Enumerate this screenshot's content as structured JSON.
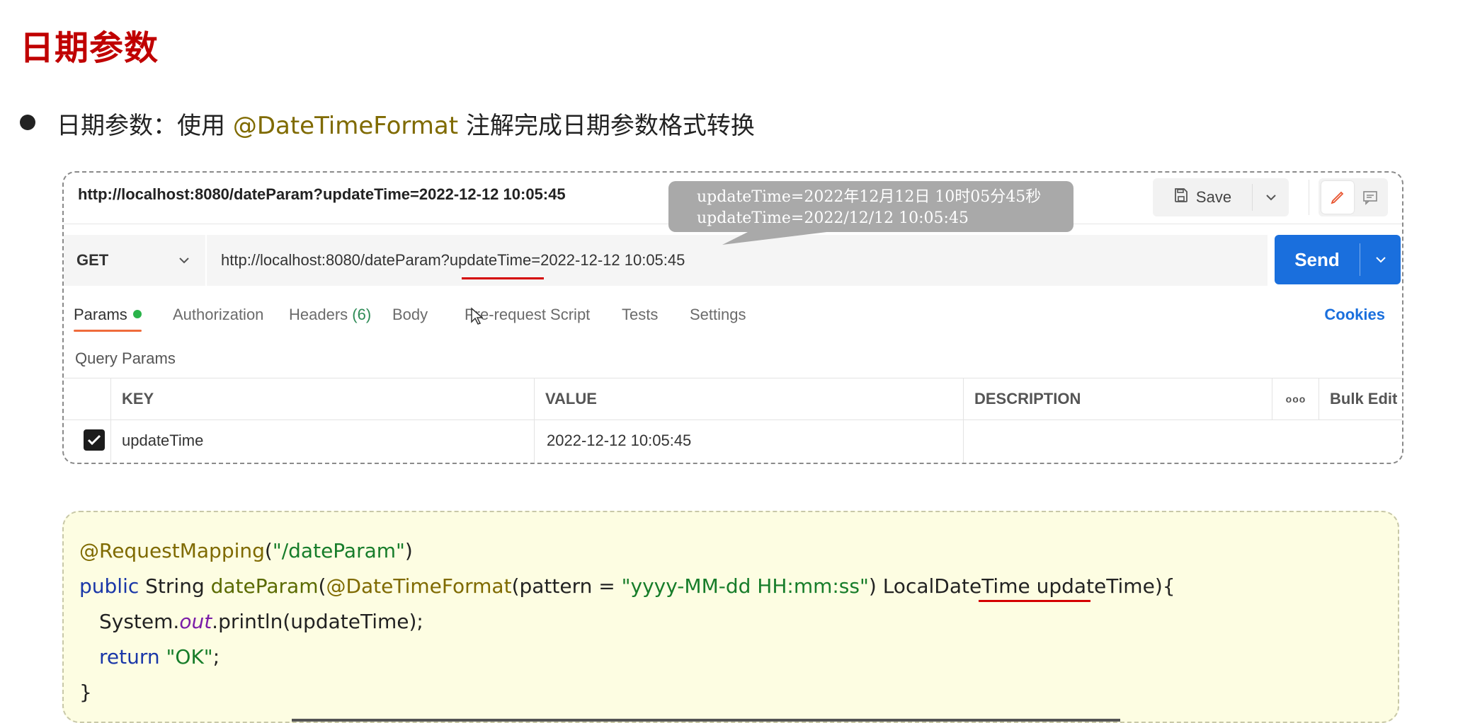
{
  "slide": {
    "title": "日期参数",
    "bullet": {
      "prefix": "日期参数：使用 ",
      "highlight": "@DateTimeFormat",
      "suffix": " 注解完成日期参数格式转换"
    }
  },
  "postman": {
    "top_url": "http://localhost:8080/dateParam?updateTime=2022-12-12 10:05:45",
    "save_label": "Save",
    "method": "GET",
    "request_url": "http://localhost:8080/dateParam?updateTime=2022-12-12 10:05:45",
    "send_label": "Send",
    "tabs": {
      "params": "Params",
      "authorization": "Authorization",
      "headers": "Headers",
      "headers_count": "(6)",
      "body": "Body",
      "prerequest": "Pre-request Script",
      "tests": "Tests",
      "settings": "Settings",
      "cookies": "Cookies"
    },
    "query_params_label": "Query Params",
    "table": {
      "headers": {
        "key": "KEY",
        "value": "VALUE",
        "description": "DESCRIPTION",
        "more": "ooo",
        "bulk_edit": "Bulk Edit"
      },
      "rows": [
        {
          "key": "updateTime",
          "value": "2022-12-12 10:05:45",
          "description": "",
          "checked": true
        }
      ]
    }
  },
  "tooltip": {
    "line1": "updateTime=2022年12月12日 10时05分45秒",
    "line2": "updateTime=2022/12/12 10:05:45"
  },
  "code": {
    "line1": {
      "annotation": "@RequestMapping",
      "p_open": "(",
      "string": "\"/dateParam\"",
      "p_close": ")"
    },
    "line2": {
      "kw": "public",
      "type": " String ",
      "fn": "dateParam",
      "paren": "(",
      "annotation": "@DateTimeFormat",
      "attr": "(pattern = ",
      "string": "\"yyyy-MM-dd HH:mm:ss\"",
      "after": ") LocalDateTime ",
      "param": "updateTime",
      "end": "){"
    },
    "line3": {
      "pre": "System.",
      "field": "out",
      "post": ".println(updateTime);"
    },
    "line4": {
      "kw": "return",
      "string": "\"OK\"",
      "end": ";"
    },
    "line5": "}"
  }
}
